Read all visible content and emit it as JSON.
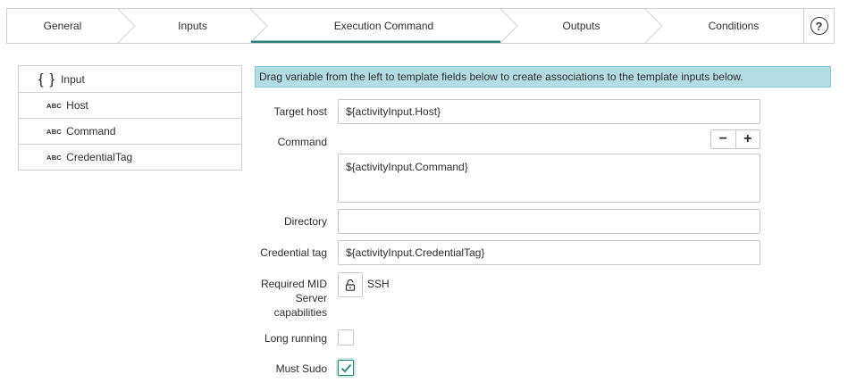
{
  "steps": [
    {
      "label": "General"
    },
    {
      "label": "Inputs"
    },
    {
      "label": "Execution Command"
    },
    {
      "label": "Outputs"
    },
    {
      "label": "Conditions"
    }
  ],
  "active_step": "Execution Command",
  "help_symbol": "?",
  "variables": {
    "root": {
      "label": "Input",
      "icon": "braces-icon",
      "symbol": "{ }"
    },
    "children": [
      {
        "type_badge": "ABC",
        "label": "Host"
      },
      {
        "type_badge": "ABC",
        "label": "Command"
      },
      {
        "type_badge": "ABC",
        "label": "CredentialTag"
      }
    ]
  },
  "banner": {
    "text": "Drag variable from the left to template fields below to create associations to the template inputs below."
  },
  "form": {
    "target_host": {
      "label": "Target host",
      "value": "${activityInput.Host}"
    },
    "command": {
      "label": "Command",
      "value": "${activityInput.Command}",
      "minus": "−",
      "plus": "+"
    },
    "directory": {
      "label": "Directory",
      "value": ""
    },
    "credential_tag": {
      "label": "Credential tag",
      "value": "${activityInput.CredentialTag}"
    },
    "capabilities": {
      "label_line1": "Required MID",
      "label_line2": "Server",
      "label_line3": "capabilities",
      "value": "SSH"
    },
    "long_running": {
      "label": "Long running",
      "checked": false
    },
    "must_sudo": {
      "label": "Must Sudo",
      "checked": true
    }
  },
  "colors": {
    "accent": "#2b8279",
    "banner_bg": "#b3dde3",
    "border": "#cfd3d6"
  }
}
